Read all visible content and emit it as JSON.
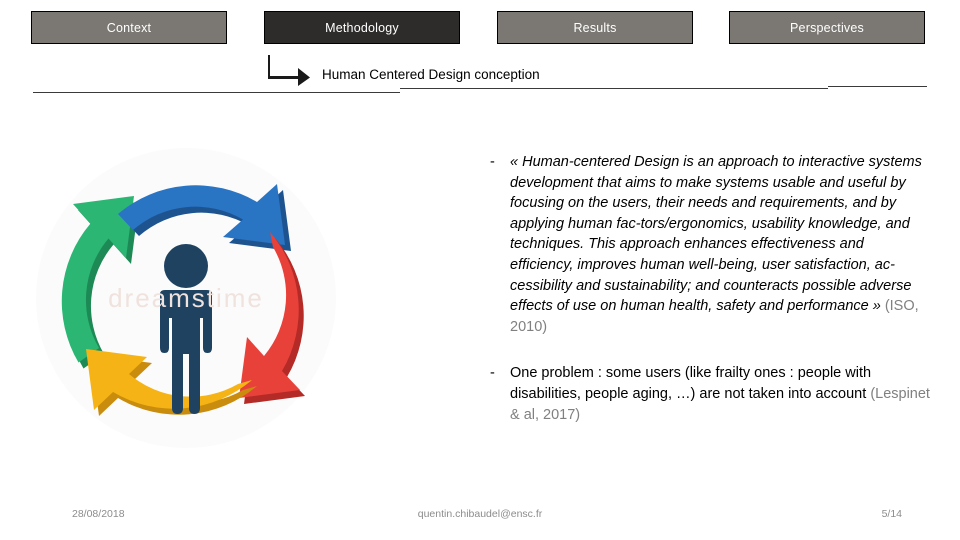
{
  "nav": {
    "tabs": [
      {
        "label": "Context",
        "active": false
      },
      {
        "label": "Methodology",
        "active": true
      },
      {
        "label": "Results",
        "active": false
      },
      {
        "label": "Perspectives",
        "active": false
      }
    ],
    "inactive_color": "#7b7873",
    "active_color": "#2e2c2b"
  },
  "subheading": {
    "arrow_icon": "elbow-arrow-right-icon",
    "text": "Human Centered Design conception"
  },
  "graphic": {
    "name": "human-centered-design-cycle",
    "center_icon": "person-figure-icon",
    "center_icon_color": "#1e4260",
    "watermark": "dreamstime",
    "arcs": [
      {
        "name": "arc-top",
        "color": "#2a74c4",
        "shadow": "#1d5490"
      },
      {
        "name": "arc-right",
        "color": "#e8413a",
        "shadow": "#b32a26"
      },
      {
        "name": "arc-bottom",
        "color": "#f5b316",
        "shadow": "#c98c0c"
      },
      {
        "name": "arc-left",
        "color": "#2bb673",
        "shadow": "#1d8a55"
      }
    ]
  },
  "content": {
    "bullets": [
      {
        "marker": "-",
        "style": "italic",
        "quote": "« Human-centered Design is an approach to interactive systems development that aims to make systems usable and useful by focusing on the users, their needs and requirements, and by applying human fac-tors/ergonomics, usability knowledge, and techniques. This approach enhances effectiveness and efficiency, improves human well-being, user satisfaction, ac-cessibility and sustainability; and counteracts possible adverse effects of use on human health, safety and performance »",
        "lines": [
          "« Human-centered Design is an approach to interactive",
          "systems development that aims to make systems",
          "usable and useful by focusing on the users, their needs",
          "and requirements, and by applying human fac-",
          "tors/ergonomics, usability knowledge, and techniques.",
          "This approach enhances effectiveness and efficiency,",
          "improves human well-being, user satisfaction, ac-",
          "cessibility and sustainability; and counteracts possible",
          "adverse effects of use on human health, safety and",
          "performance »"
        ],
        "citation": "(ISO, 2010)"
      },
      {
        "marker": "-",
        "style": "regular",
        "quote": "One problem : some users (like frailty ones : people with disabilities, people aging, …) are not taken into account",
        "lines": [
          "One problem : some users (like frailty ones : people",
          "with disabilities, people aging, …) are not taken into",
          "account"
        ],
        "citation": "(Lespinet & al, 2017)"
      }
    ]
  },
  "footer": {
    "date": "28/08/2018",
    "email": "quentin.chibaudel@ensc.fr",
    "page": "5/14"
  }
}
